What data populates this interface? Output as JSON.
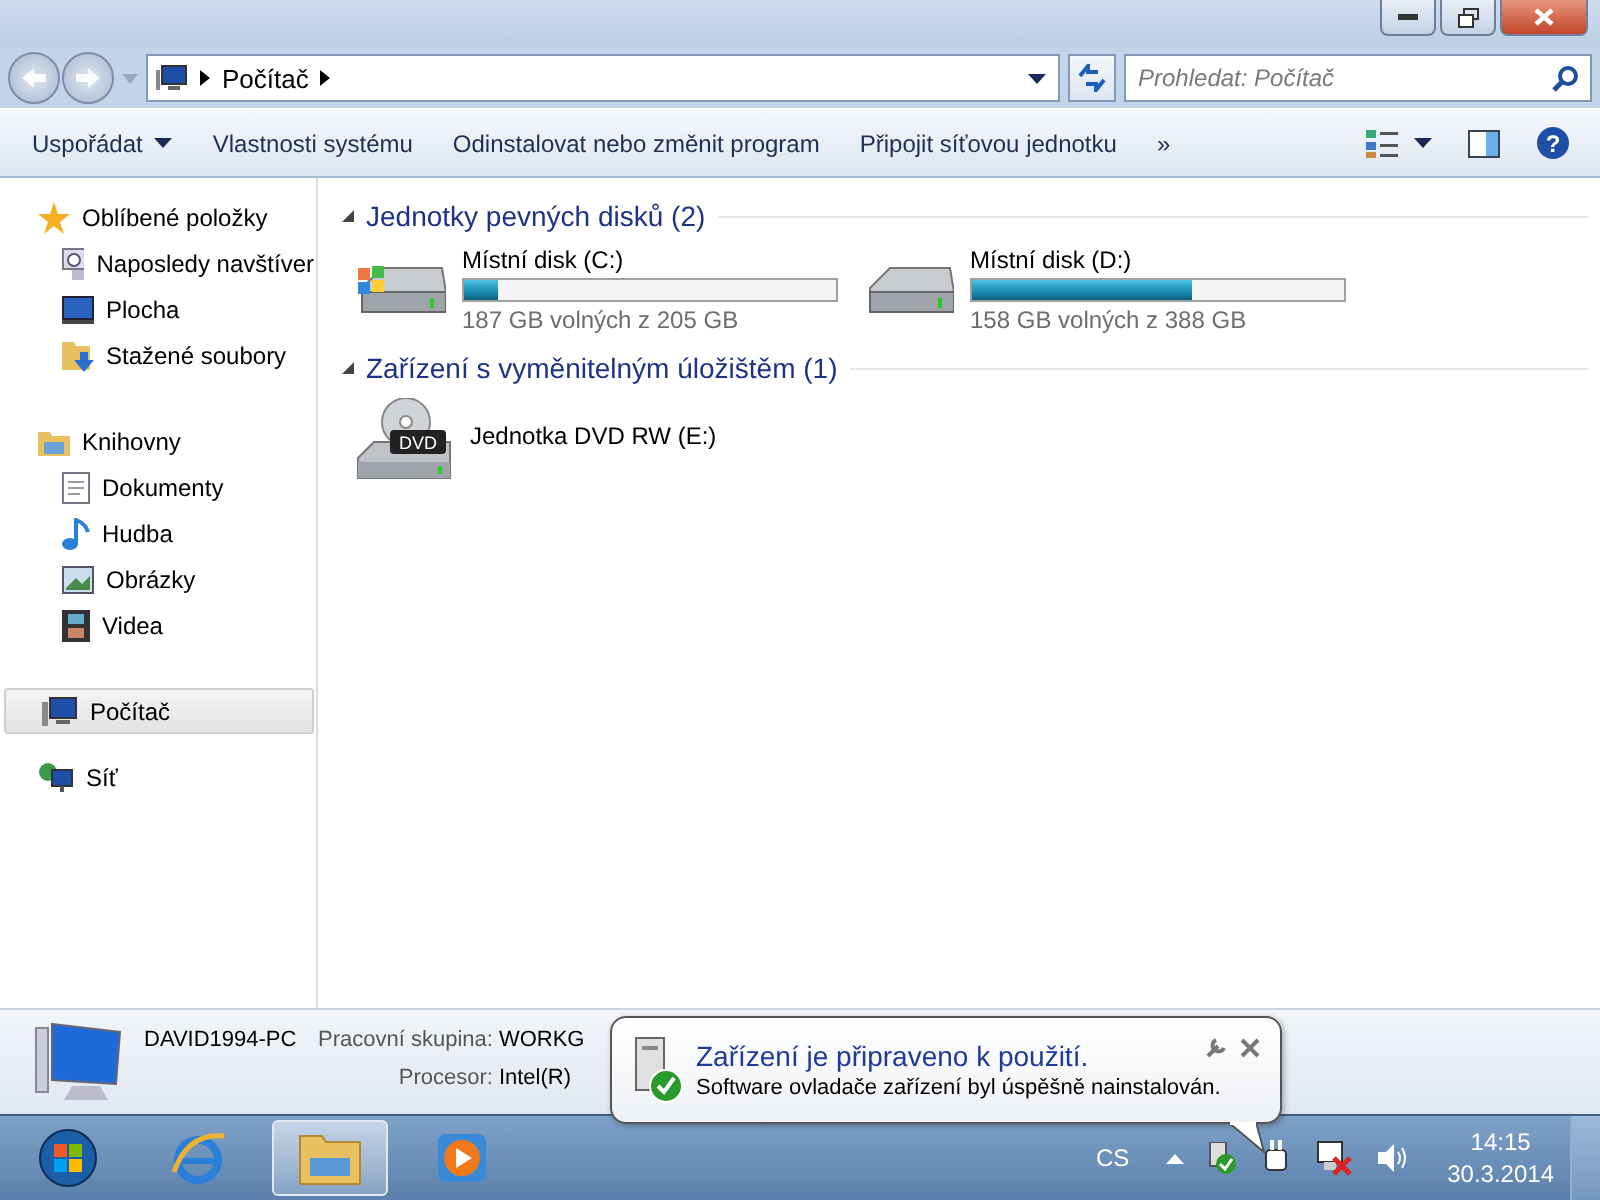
{
  "address": {
    "crumbs": [
      "Počítač"
    ],
    "search_placeholder": "Prohledat: Počítač"
  },
  "toolbar": {
    "items": [
      {
        "label": "Uspořádat",
        "dropdown": true
      },
      {
        "label": "Vlastnosti systému",
        "dropdown": false
      },
      {
        "label": "Odinstalovat nebo změnit program",
        "dropdown": false
      },
      {
        "label": "Připojit síťovou jednotku",
        "dropdown": false
      }
    ],
    "overflow": "»",
    "help": "?"
  },
  "sidebar": {
    "groups": [
      {
        "label": "Oblíbené položky",
        "selected": false,
        "children": [
          {
            "label": "Naposledy navštíver",
            "selected": false
          },
          {
            "label": "Plocha",
            "selected": false
          },
          {
            "label": "Stažené soubory",
            "selected": false
          }
        ]
      },
      {
        "label": "Knihovny",
        "selected": false,
        "children": [
          {
            "label": "Dokumenty",
            "selected": false
          },
          {
            "label": "Hudba",
            "selected": false
          },
          {
            "label": "Obrázky",
            "selected": false
          },
          {
            "label": "Videa",
            "selected": false
          }
        ]
      },
      {
        "label": "Počítač",
        "selected": true
      },
      {
        "label": "Síť",
        "selected": false
      }
    ]
  },
  "sections": [
    {
      "title": "Jednotky pevných disků (2)",
      "items": [
        {
          "kind": "disk",
          "name": "Místní disk (C:)",
          "level": 0.09,
          "free": "187 GB volných z 205 GB"
        },
        {
          "kind": "disk",
          "name": "Místní disk (D:)",
          "level": 0.59,
          "free": "158 GB volných z 388 GB"
        }
      ]
    },
    {
      "title": "Zařízení s vyměnitelným úložištěm (1)",
      "items": [
        {
          "kind": "dvd",
          "name": "Jednotka DVD RW (E:)",
          "badge": "DVD"
        }
      ]
    }
  ],
  "details": {
    "computer": "DAVID1994-PC",
    "rows": [
      {
        "label": "Pracovní skupina:",
        "value": "WORKG"
      },
      {
        "label": "Procesor:",
        "value": "Intel(R)"
      }
    ]
  },
  "balloon": {
    "title": "Zařízení je připraveno k použití.",
    "message": "Software ovladače zařízení byl úspěšně nainstalován."
  },
  "taskbar": {
    "apps": [
      {
        "selected": false
      },
      {
        "selected": true
      },
      {
        "selected": false
      }
    ],
    "language": "CS",
    "time": "14:15",
    "date": "30.3.2014"
  }
}
